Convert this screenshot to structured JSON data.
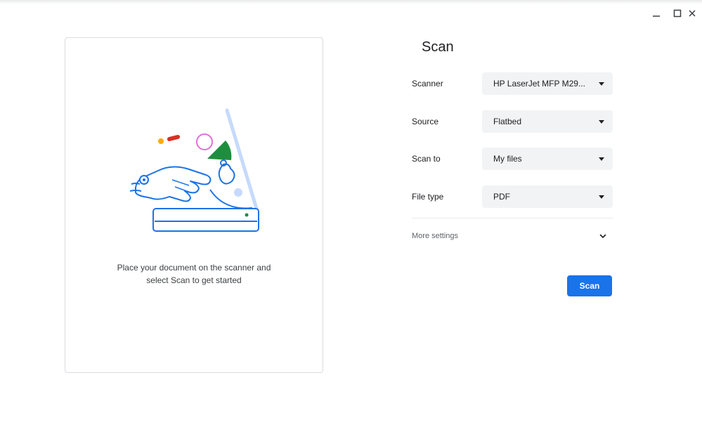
{
  "app": {
    "title": "Scan"
  },
  "window_controls": [
    {
      "name": "minimize-icon",
      "glyph": "—"
    },
    {
      "name": "maximize-icon",
      "glyph": "□"
    },
    {
      "name": "close-icon",
      "glyph": "✕"
    }
  ],
  "preview": {
    "illustration": "scanner-illustration",
    "help_line1": "Place your document on the scanner and",
    "help_line2": "select Scan to get started"
  },
  "settings": {
    "scanner": {
      "label": "Scanner",
      "value": "HP LaserJet MFP M29..."
    },
    "source": {
      "label": "Source",
      "value": "Flatbed"
    },
    "scan_to": {
      "label": "Scan to",
      "value": "My files"
    },
    "file_type": {
      "label": "File type",
      "value": "PDF"
    },
    "more_settings": "More settings"
  },
  "actions": {
    "scan_label": "Scan"
  },
  "colors": {
    "accent": "#1a73e8",
    "select_bg": "#f1f3f4",
    "border": "#dadce0"
  }
}
